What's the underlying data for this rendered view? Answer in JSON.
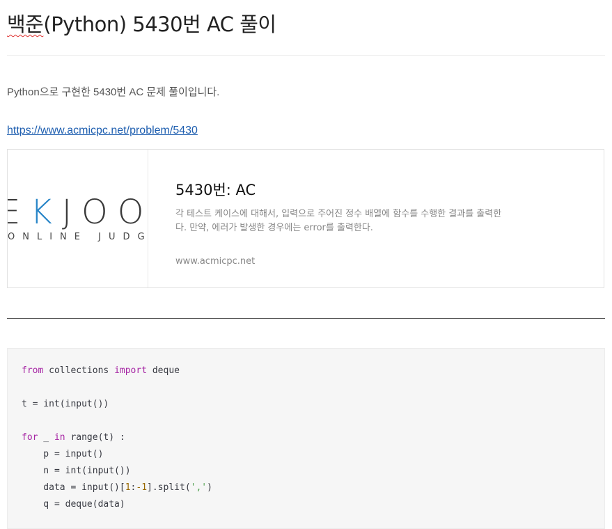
{
  "article": {
    "title_spellchecked": "백준",
    "title_rest": "(Python) 5430번 AC 풀이",
    "intro": "Python으로 구현한 5430번 AC 문제 풀이입니다.",
    "link": "https://www.acmicpc.net/problem/5430"
  },
  "card": {
    "logo_text_a": "E",
    "logo_text_b": "K",
    "logo_text_c": "JOO",
    "logo_sub": "ONLINE JUDGE",
    "title": "5430번: AC",
    "description": "각 테스트 케이스에 대해서, 입력으로 주어진 정수 배열에 함수를 수행한 결과를 출력한다. 만약, 에러가 발생한 경우에는 error를 출력한다.",
    "site": "www.acmicpc.net"
  },
  "code": {
    "lines": [
      [
        {
          "t": "from",
          "c": "kw"
        },
        {
          "t": " collections "
        },
        {
          "t": "import",
          "c": "kw"
        },
        {
          "t": " deque"
        }
      ],
      [],
      [
        {
          "t": "t = int(input())"
        }
      ],
      [],
      [
        {
          "t": "for",
          "c": "kw"
        },
        {
          "t": " _ "
        },
        {
          "t": "in",
          "c": "kw"
        },
        {
          "t": " range(t) :"
        }
      ],
      [
        {
          "t": "    p = input()"
        }
      ],
      [
        {
          "t": "    n = int(input())"
        }
      ],
      [
        {
          "t": "    data = input()["
        },
        {
          "t": "1",
          "c": "num"
        },
        {
          "t": ":"
        },
        {
          "t": "-1",
          "c": "num"
        },
        {
          "t": "].split("
        },
        {
          "t": "','",
          "c": "str"
        },
        {
          "t": ")"
        }
      ],
      [
        {
          "t": "    q = deque(data)"
        }
      ]
    ]
  },
  "colors": {
    "link": "#1f5fb0",
    "logo_accent": "#2a86c8",
    "code_keyword": "#a626a4",
    "code_number": "#986801",
    "code_string": "#50a14f",
    "code_background": "#f6f6f6"
  }
}
